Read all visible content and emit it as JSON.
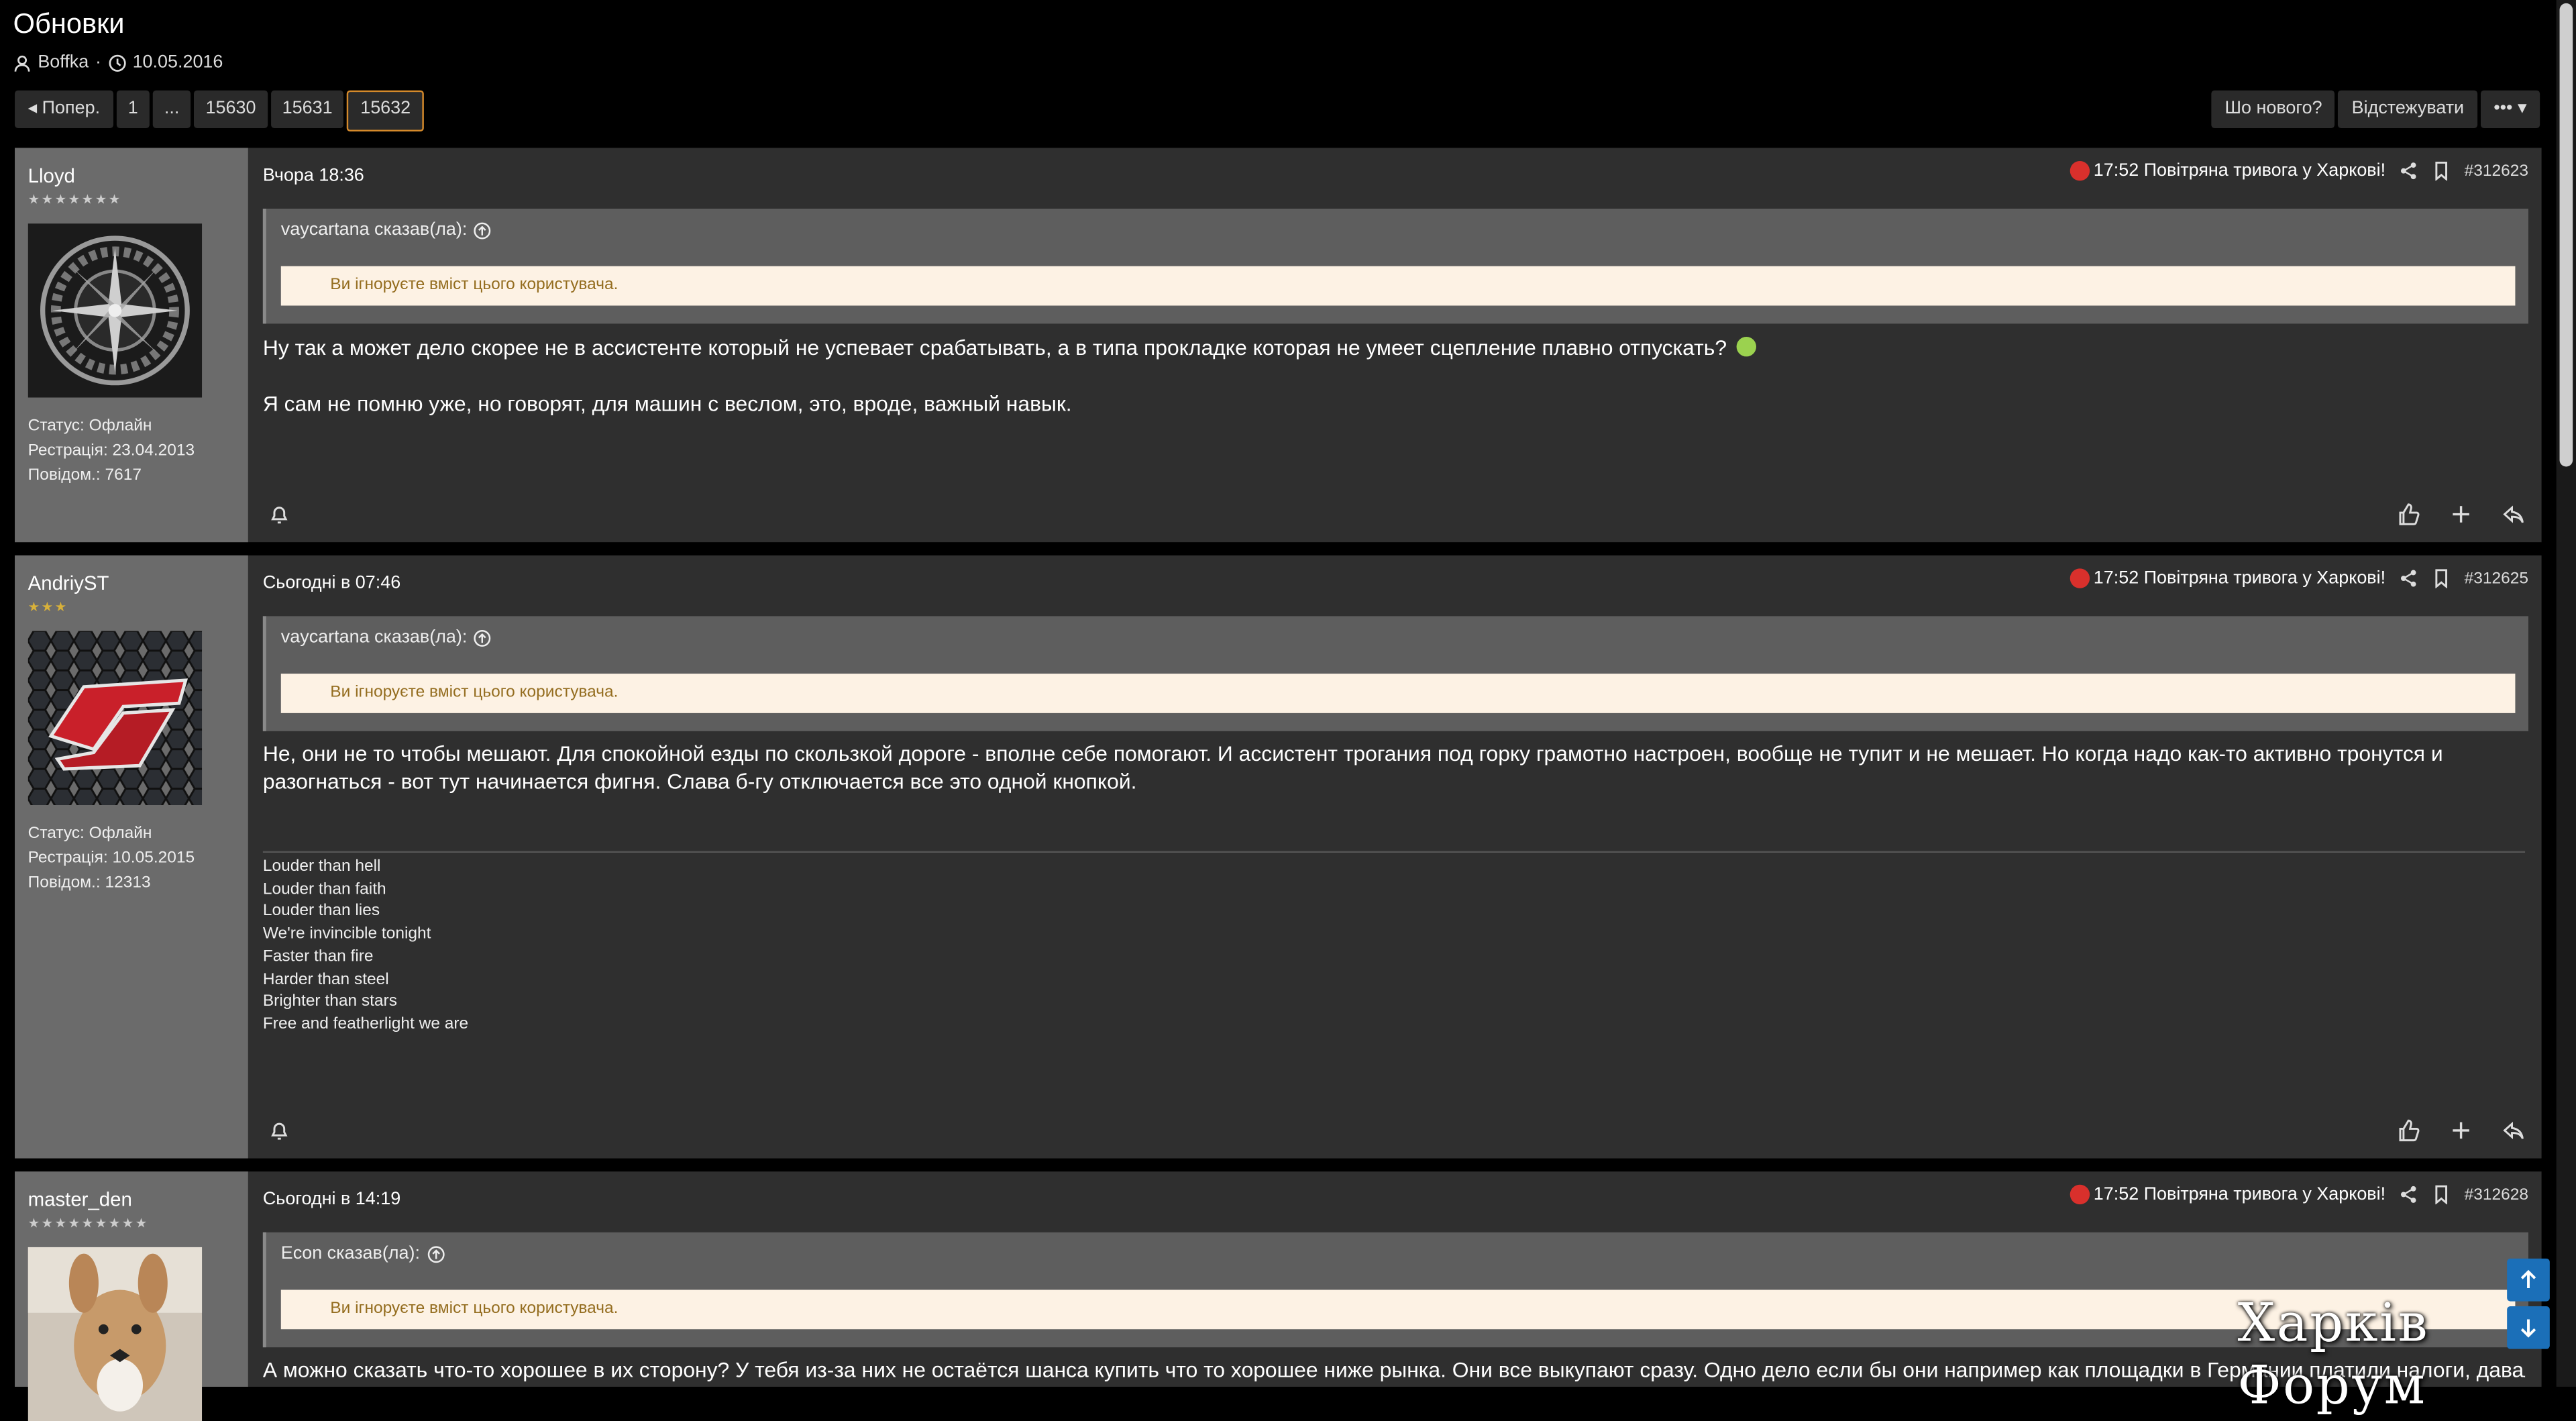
{
  "thread": {
    "title": "Обновки",
    "author": "Boffka",
    "date": "10.05.2016"
  },
  "pagination": {
    "prev_label": "Попер.",
    "pages": [
      "1",
      "...",
      "15630",
      "15631",
      "15632"
    ],
    "current": "15632"
  },
  "actions": {
    "whats_new": "Шо нового?",
    "watch": "Відстежувати",
    "more": "•••"
  },
  "posts": [
    {
      "username": "Lloyd",
      "stars": "★★★★★★★",
      "status": "Статус: Офлайн",
      "registered": "Рестрація: 23.04.2013",
      "posts_count": "Повідом.: 7617",
      "time": "Вчора 18:36",
      "alert": "17:52 Повітряна тривога у Харкові!",
      "number": "#312623",
      "quote_author": "vaycartana сказав(ла):",
      "ignored": "Ви ігноруєте вміст цього користувача.",
      "body": [
        "Ну так а может дело скорее не в ассистенте который не успевает срабатывать, а в типа прокладке которая не умеет сцепление плавно отпускать?",
        "Я сам не помню уже, но говорят, для машин с веслом, это, вроде, важный навык."
      ]
    },
    {
      "username": "AndriyST",
      "stars": "★★★",
      "status": "Статус: Офлайн",
      "registered": "Рестрація: 10.05.2015",
      "posts_count": "Повідом.: 12313",
      "time": "Сьогодні в 07:46",
      "alert": "17:52 Повітряна тривога у Харкові!",
      "number": "#312625",
      "quote_author": "vaycartana сказав(ла):",
      "ignored": "Ви ігноруєте вміст цього користувача.",
      "body": [
        "Не, они не то чтобы мешают. Для спокойной езды по скользкой дороге - вполне себе помогают. И ассистент трогания под горку грамотно настроен, вообще не тупит и не мешает. Но когда надо как-то активно тронутся и разогнаться - вот тут начинается фигня. Слава б-гу отключается все это одной кнопкой."
      ],
      "signature": [
        "Louder than hell",
        "Louder than faith",
        "Louder than lies",
        "We're invincible tonight",
        "Faster than fire",
        "Harder than steel",
        "Brighter than stars",
        "Free and featherlight we are"
      ]
    },
    {
      "username": "master_den",
      "stars": "★★★★★★★★★",
      "time": "Сьогодні в 14:19",
      "alert": "17:52 Повітряна тривога у Харкові!",
      "number": "#312628",
      "quote_author": "Econ сказав(ла):",
      "ignored": "Ви ігноруєте вміст цього користувача.",
      "body": [
        "А можно сказать что-то хорошее в их сторону? У тебя из-за них не остаётся шанса купить что то хорошее ниже рынка. Они все выкупают сразу. Одно дело если бы они например как площадки в Германии платили налоги, давали доп"
      ]
    }
  ],
  "logo_text": "Харків Форум"
}
